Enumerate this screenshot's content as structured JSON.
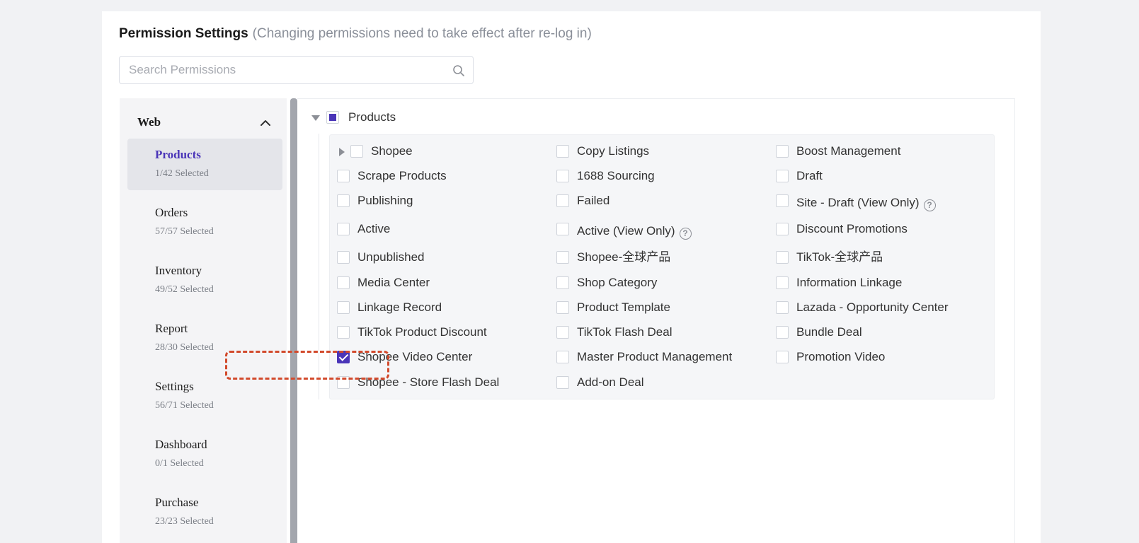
{
  "header": {
    "title": "Permission Settings",
    "note": "(Changing permissions need to take effect after re-log in)"
  },
  "search": {
    "placeholder": "Search Permissions",
    "value": ""
  },
  "sidebar": {
    "section": "Web",
    "items": [
      {
        "label": "Products",
        "count": "1/42 Selected",
        "active": true
      },
      {
        "label": "Orders",
        "count": "57/57 Selected"
      },
      {
        "label": "Inventory",
        "count": "49/52 Selected"
      },
      {
        "label": "Report",
        "count": "28/30 Selected"
      },
      {
        "label": "Settings",
        "count": "56/71 Selected"
      },
      {
        "label": "Dashboard",
        "count": "0/1 Selected"
      },
      {
        "label": "Purchase",
        "count": "23/23 Selected"
      }
    ]
  },
  "group": {
    "label": "Products",
    "state": "partial"
  },
  "permissions": [
    {
      "label": "Shopee",
      "checked": false,
      "expandable": true
    },
    {
      "label": "Copy Listings",
      "checked": false
    },
    {
      "label": "Boost Management",
      "checked": false
    },
    {
      "label": "Scrape Products",
      "checked": false
    },
    {
      "label": "1688 Sourcing",
      "checked": false
    },
    {
      "label": "Draft",
      "checked": false
    },
    {
      "label": "Publishing",
      "checked": false
    },
    {
      "label": "Failed",
      "checked": false
    },
    {
      "label": "Site - Draft (View Only)",
      "checked": false,
      "help": "?"
    },
    {
      "label": "Active",
      "checked": false
    },
    {
      "label": "Active (View Only)",
      "checked": false,
      "help": "?"
    },
    {
      "label": "Discount Promotions",
      "checked": false
    },
    {
      "label": "Unpublished",
      "checked": false
    },
    {
      "label": "Shopee-全球产品",
      "checked": false
    },
    {
      "label": "TikTok-全球产品",
      "checked": false
    },
    {
      "label": "Media Center",
      "checked": false
    },
    {
      "label": "Shop Category",
      "checked": false
    },
    {
      "label": "Information Linkage",
      "checked": false
    },
    {
      "label": "Linkage Record",
      "checked": false
    },
    {
      "label": "Product Template",
      "checked": false
    },
    {
      "label": "Lazada - Opportunity Center",
      "checked": false
    },
    {
      "label": "TikTok Product Discount",
      "checked": false
    },
    {
      "label": "TikTok Flash Deal",
      "checked": false
    },
    {
      "label": "Bundle Deal",
      "checked": false
    },
    {
      "label": "Shopee Video Center",
      "checked": true,
      "highlighted": true
    },
    {
      "label": "Master Product Management",
      "checked": false
    },
    {
      "label": "Promotion Video",
      "checked": false
    },
    {
      "label": "Shopee - Store Flash Deal",
      "checked": false
    },
    {
      "label": "Add-on Deal",
      "checked": false
    }
  ],
  "colors": {
    "accent": "#4a35b8",
    "highlight": "#d24a2c"
  }
}
